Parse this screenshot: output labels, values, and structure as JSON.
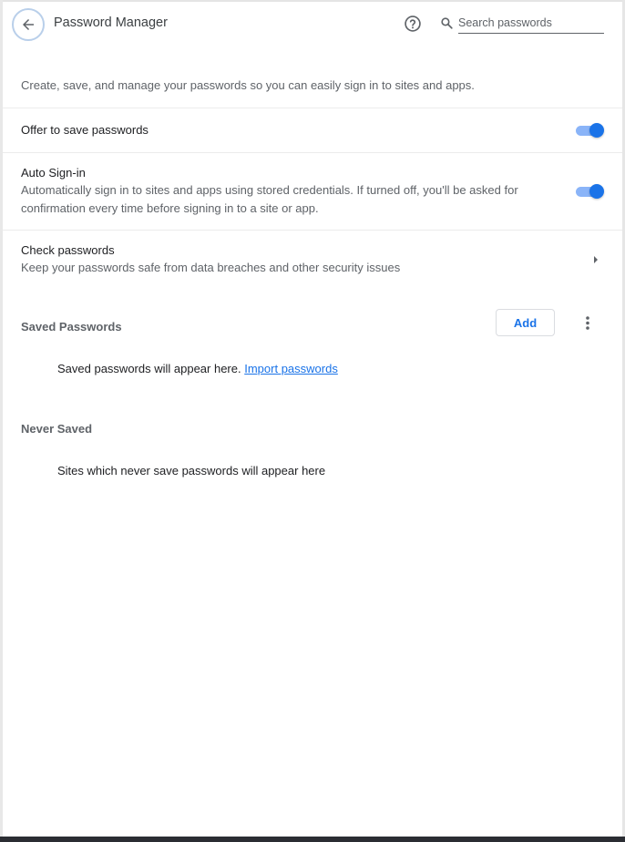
{
  "header": {
    "back_icon": "arrow-left-icon",
    "title": "Password Manager",
    "help_icon": "help-circle-icon",
    "search": {
      "icon": "search-icon",
      "placeholder": "Search passwords",
      "value": ""
    }
  },
  "intro": "Create, save, and manage your passwords so you can easily sign in to sites and apps.",
  "settings": [
    {
      "title": "Offer to save passwords",
      "control": "toggle",
      "enabled": true
    },
    {
      "title": "Auto Sign-in",
      "subtitle": "Automatically sign in to sites and apps using stored credentials. If turned off, you'll be asked for confirmation every time before signing in to a site or app.",
      "control": "toggle",
      "enabled": true
    },
    {
      "title": "Check passwords",
      "subtitle": "Keep your passwords safe from data breaches and other security issues",
      "control": "chevron-right-icon"
    }
  ],
  "saved_passwords": {
    "heading": "Saved Passwords",
    "add_label": "Add",
    "more_icon": "more-vertical-icon",
    "empty_text": "Saved passwords will appear here.",
    "import_link": "Import passwords"
  },
  "never_saved": {
    "heading": "Never Saved",
    "empty_text": "Sites which never save passwords will appear here"
  },
  "colors": {
    "accent": "#1a73e8",
    "toggle_track": "#8ab4f8",
    "secondary_text": "#5f6368"
  }
}
